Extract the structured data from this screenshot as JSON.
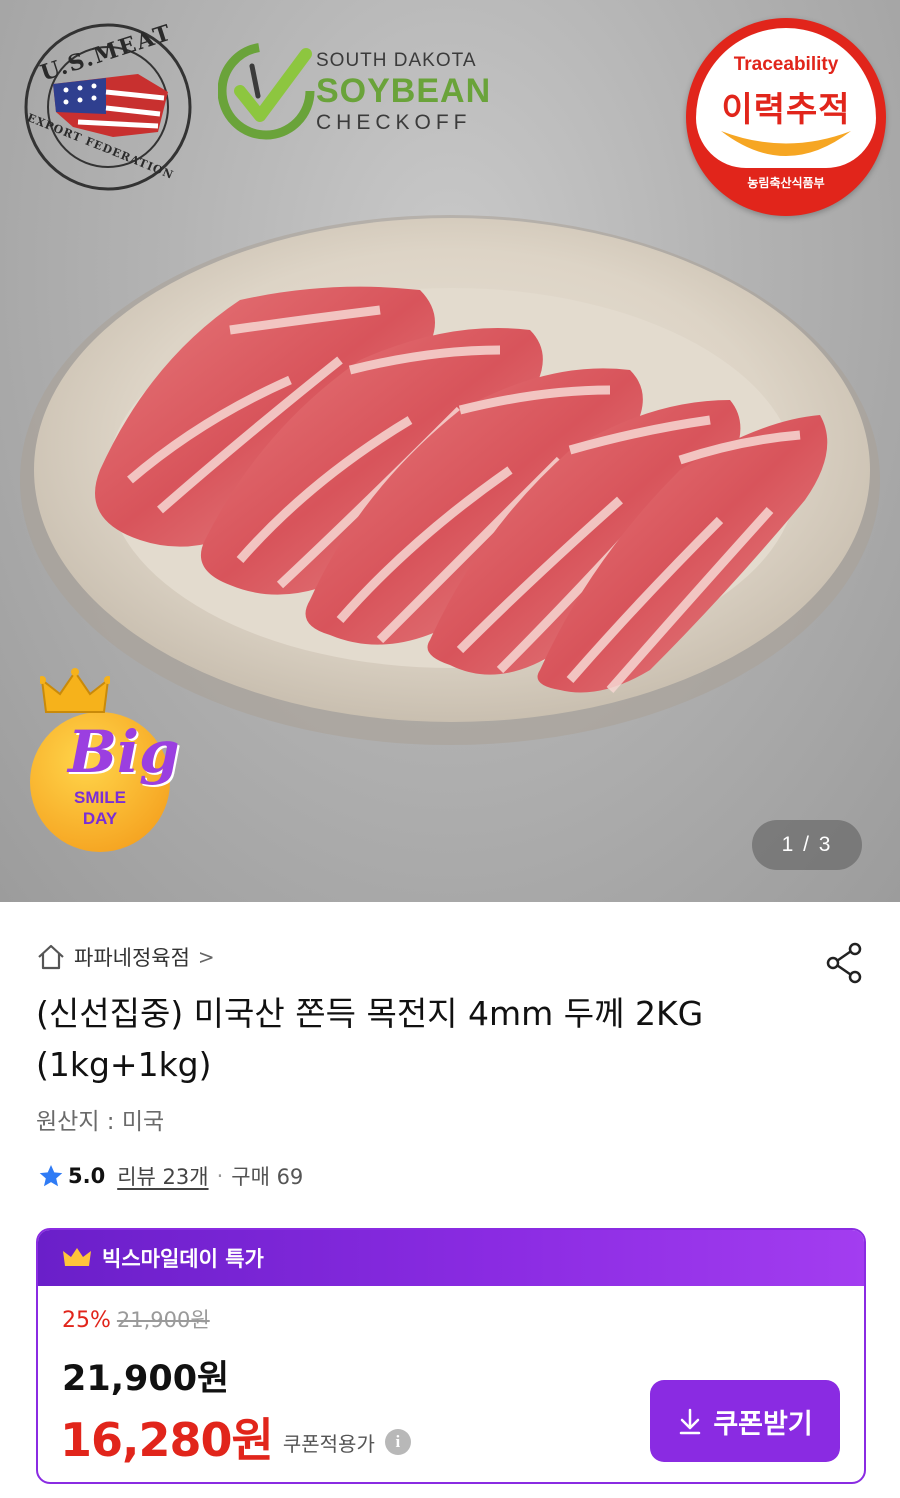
{
  "hero": {
    "usmef_badge": {
      "top_text": "U.S.MEAT",
      "bottom_text": "EXPORT FEDERATION"
    },
    "soy_badge": {
      "line1": "SOUTH DAKOTA",
      "line2": "SOYBEAN",
      "line3": "CHECKOFF"
    },
    "trace_badge": {
      "english": "Traceability",
      "korean": "이력추적",
      "ministry": "농림축산식품부"
    },
    "promo_badge": {
      "big": "Big",
      "smile": "SMILE",
      "day": "DAY"
    },
    "page_counter": "1 / 3",
    "icons": {
      "home": "home-icon",
      "share": "share-icon",
      "star": "star-icon",
      "crown": "crown-icon",
      "download": "download-icon",
      "info": "info-icon"
    }
  },
  "product": {
    "store_name": "파파네정육점",
    "store_chevron": ">",
    "title": "(신선집중) 미국산 쫀득 목전지 4mm 두께 2KG (1kg+1kg)",
    "origin": "원산지 : 미국",
    "rating": "5.0",
    "reviews": "리뷰 23개",
    "separator": "·",
    "purchases": "구매 69"
  },
  "price_box": {
    "header": "빅스마일데이 특가",
    "discount_rate": "25%",
    "original_price": "21,900원",
    "sale_price": "21,900원",
    "coupon_price": "16,280원",
    "coupon_price_label": "쿠폰적용가",
    "info_glyph": "i",
    "coupon_button": "쿠폰받기"
  },
  "colors": {
    "accent_purple": "#8a2be2",
    "price_red": "#e1251b",
    "star_blue": "#2f7bf5"
  }
}
